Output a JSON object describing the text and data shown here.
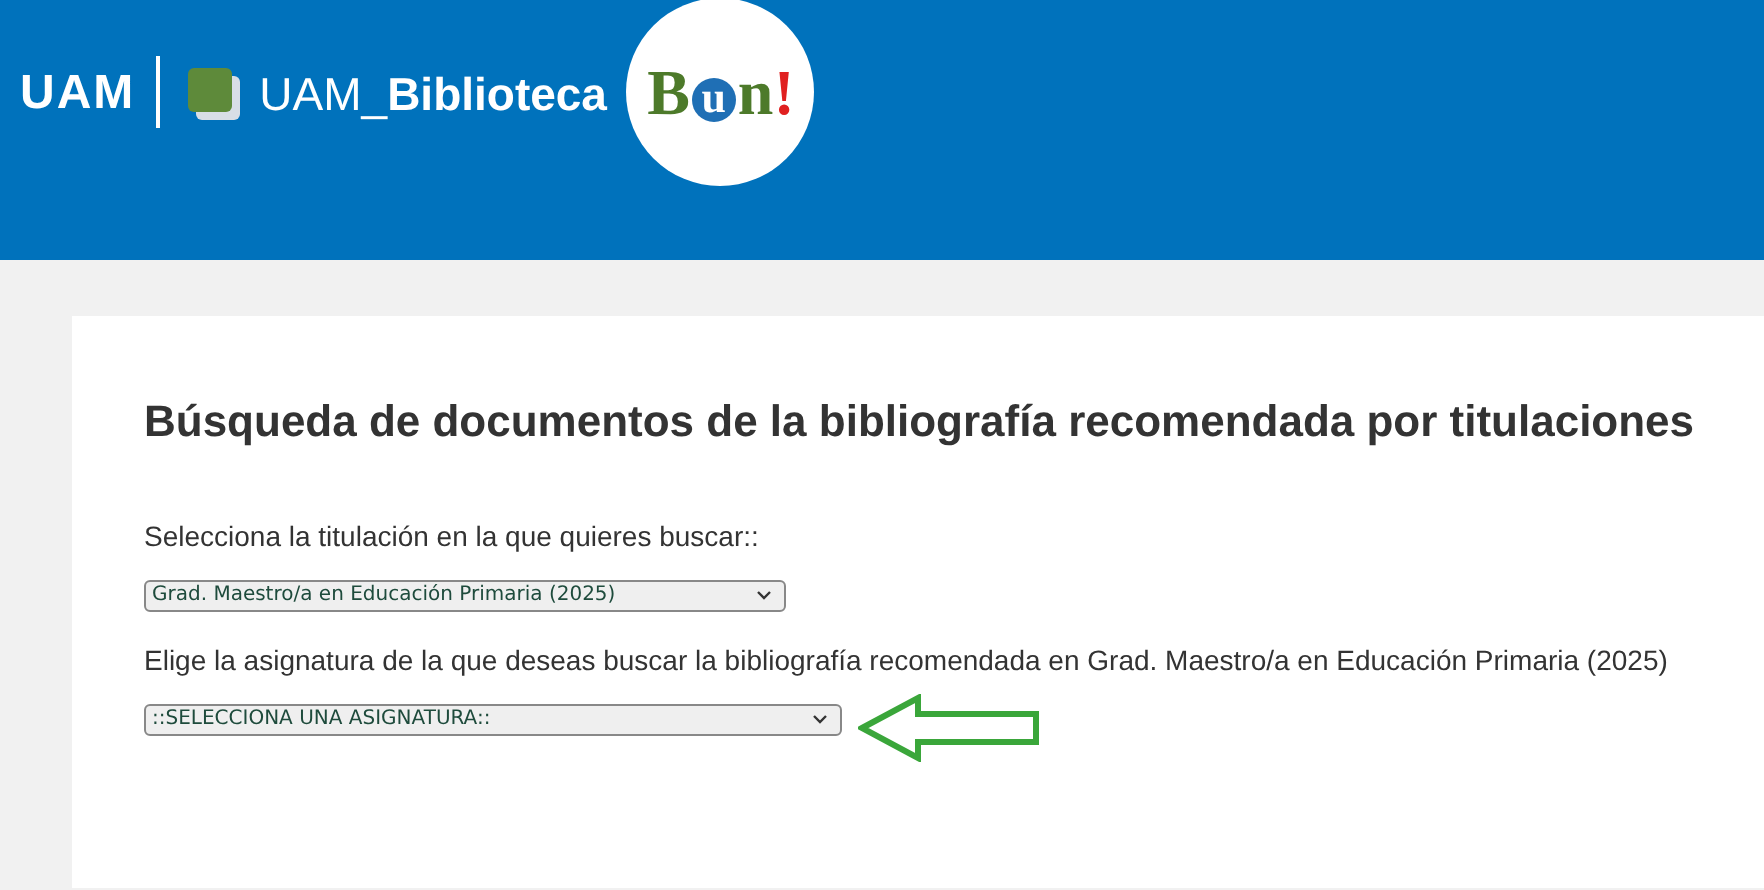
{
  "header": {
    "uam_logo": "UAM",
    "library_name": "UAM_**Biblioteca**",
    "bun_logo": "Bun!"
  },
  "main": {
    "title": "Búsqueda de documentos de la bibliografía recomendada por titulaciones",
    "fields": [
      {
        "label": "Selecciona la titulación en la que quieres buscar::",
        "value": "Grad. Maestro/a en Educación Primaria (2025)"
      },
      {
        "label": "Elige la asignatura de la que deseas buscar la bibliografía recomendada en Grad. Maestro/a en Educación Primaria (2025)",
        "value": "::SELECCIONA UNA ASIGNATURA::",
        "highlighted": true
      }
    ]
  }
}
